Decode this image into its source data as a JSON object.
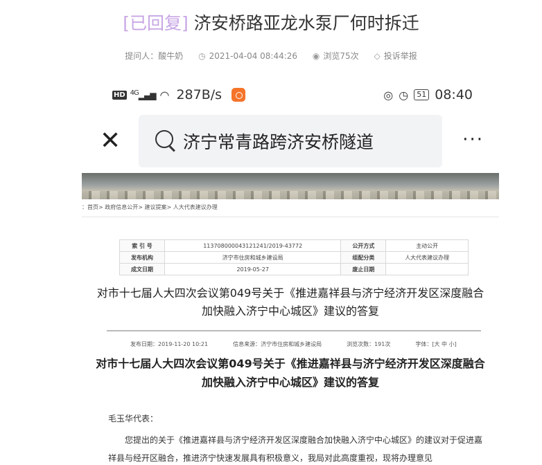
{
  "question": {
    "tag": "[已回复]",
    "title": "济安桥路亚龙水泵厂何时拆迁"
  },
  "meta": {
    "asker": "提问人：酸牛奶",
    "datetime": "2021-04-04 08:44:26",
    "views": "浏览75次",
    "report": "投诉举报"
  },
  "screenshot": {
    "status_bar": {
      "network": "4G",
      "hd": "HD",
      "speed": "287B/s",
      "battery": "51",
      "time": "08:40"
    },
    "search": {
      "query": "济宁常青路跨济安桥隧道"
    },
    "breadcrumb": "：首页> 政府信息公开> 建议提案> 人大代表建议办理",
    "info_table": [
      [
        "索 引 号",
        "113708000043121241/2019-43772",
        "公开方式",
        "主动公开"
      ],
      [
        "发布机构",
        "济宁市住房和城乡建设局",
        "组配分类",
        "人大代表建议办理"
      ],
      [
        "成文日期",
        "2019-05-27",
        "废止日期",
        ""
      ]
    ],
    "doc_title_1": "对市十七届人大四次会议第049号关于《推进嘉祥县与济宁经济开发区深度融合加快融入济宁中心城区》建议的答复",
    "pub_meta": {
      "publish_date": "发布日期：2019-11-20 10:21",
      "source": "信息来源：济宁市住房和城乡建设局",
      "view_count": "浏览次数：191次",
      "font_size": "字体：[大 中 小]"
    },
    "doc_title_2": "对市十七届人大四次会议第049号关于《推进嘉祥县与济宁经济开发区深度融合加快融入济宁中心城区》建议的答复",
    "salutation": "毛玉华代表：",
    "paragraph": "您提出的关于《推进嘉祥县与济宁经济开发区深度融合加快融入济宁中心城区》的建议对于促进嘉祥县与经开区融合，推进济宁快速发展具有积极意义，我局对此高度重视，现将办理意见"
  },
  "colors": {
    "tag": "#c8a6e6",
    "app_icon": "#f5742a",
    "search_bg": "#f2f3f5"
  }
}
